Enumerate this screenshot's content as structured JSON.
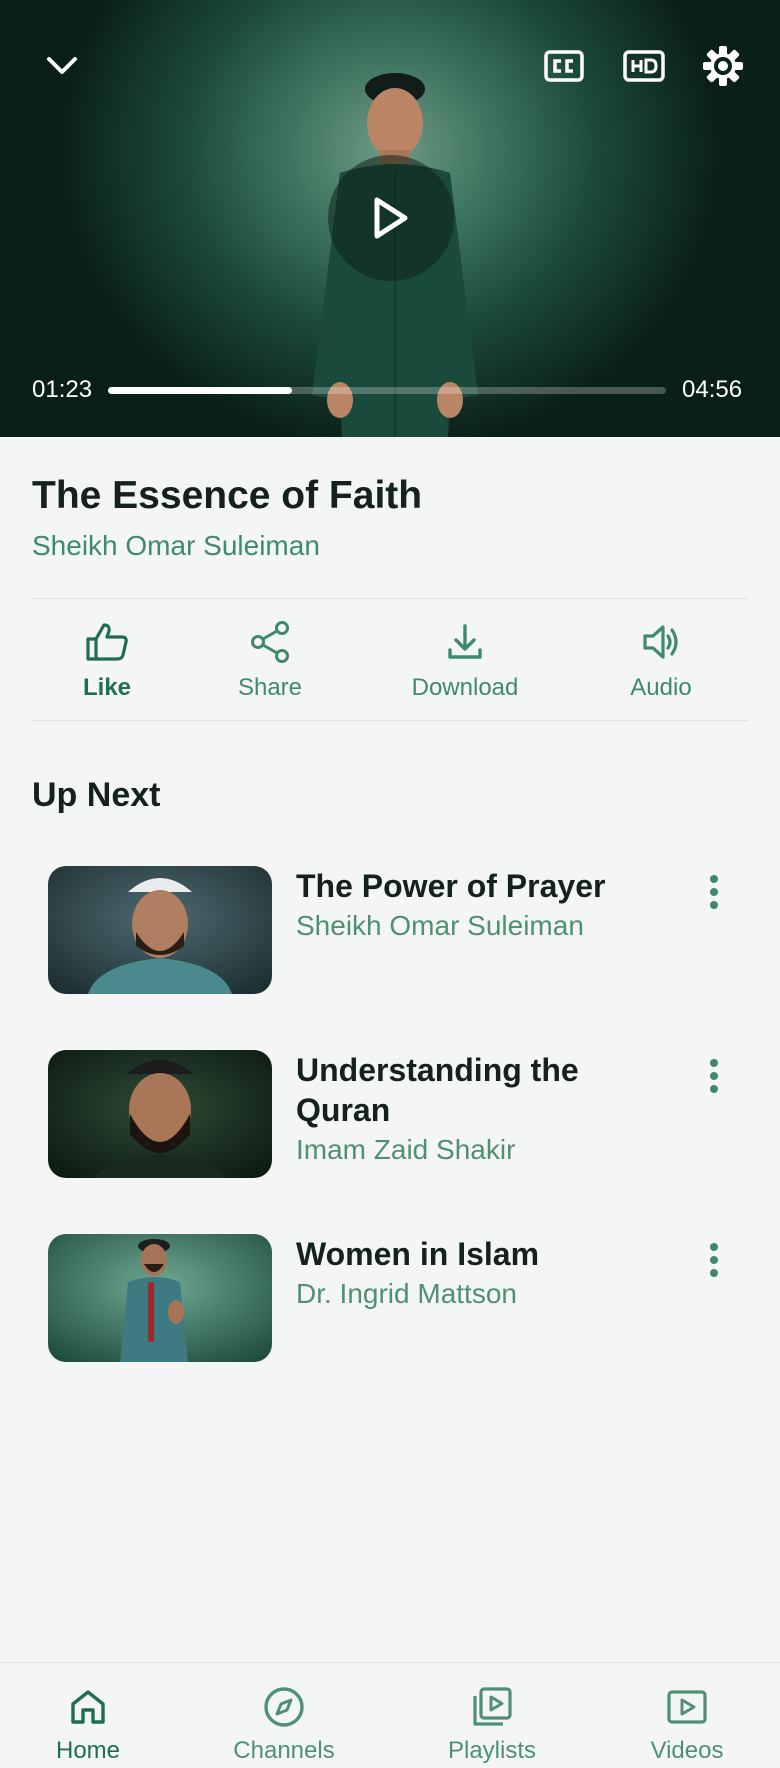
{
  "player": {
    "current_time": "01:23",
    "duration": "04:56",
    "progress_fraction": 0.33,
    "controls": {
      "collapse_icon": "chevron-down-icon",
      "captions_icon": "cc-icon",
      "quality_icon": "hd-icon",
      "settings_icon": "gear-icon",
      "play_icon": "play-icon"
    }
  },
  "video": {
    "title": "The Essence of Faith",
    "channel": "Sheikh Omar Suleiman"
  },
  "actions": [
    {
      "label": "Like",
      "icon": "thumbs-up-icon",
      "active": true
    },
    {
      "label": "Share",
      "icon": "share-icon",
      "active": false
    },
    {
      "label": "Download",
      "icon": "download-icon",
      "active": false
    },
    {
      "label": "Audio",
      "icon": "speaker-icon",
      "active": false
    }
  ],
  "up_next": {
    "heading": "Up Next",
    "items": [
      {
        "title": "The Power of Prayer",
        "speaker": "Sheikh Omar Suleiman"
      },
      {
        "title": "Understanding the Quran",
        "speaker": "Imam Zaid Shakir"
      },
      {
        "title": "Women in Islam",
        "speaker": "Dr. Ingrid Mattson"
      }
    ]
  },
  "nav": [
    {
      "label": "Home",
      "icon": "home-icon",
      "active": true
    },
    {
      "label": "Channels",
      "icon": "compass-icon",
      "active": false
    },
    {
      "label": "Playlists",
      "icon": "playlist-icon",
      "active": false
    },
    {
      "label": "Videos",
      "icon": "video-icon",
      "active": false
    }
  ],
  "colors": {
    "accent": "#1f6e4f",
    "accent_light": "#3f8a6c",
    "background": "#f4f6f5",
    "text": "#14211c"
  }
}
